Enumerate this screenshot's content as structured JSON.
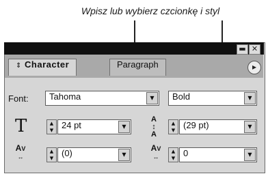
{
  "annotation": {
    "caption": "Wpisz lub wybierz czcionkę i styl"
  },
  "panel": {
    "window_buttons": {
      "minimize": "▬",
      "close": "✕"
    },
    "tabs": [
      {
        "label": "Character",
        "active": true,
        "icon": "updown-arrows"
      },
      {
        "label": "Paragraph",
        "active": false
      }
    ],
    "menu_button_glyph": "▸",
    "font": {
      "label": "Font:",
      "family": "Tahoma",
      "style": "Bold"
    },
    "size": {
      "value": "24 pt",
      "icon": "font-size-icon"
    },
    "leading": {
      "value": "(29 pt)",
      "icon": "leading-icon"
    },
    "kerning": {
      "value": "(0)",
      "icon": "kerning-icon"
    },
    "tracking": {
      "value": "0",
      "icon": "tracking-icon"
    }
  }
}
